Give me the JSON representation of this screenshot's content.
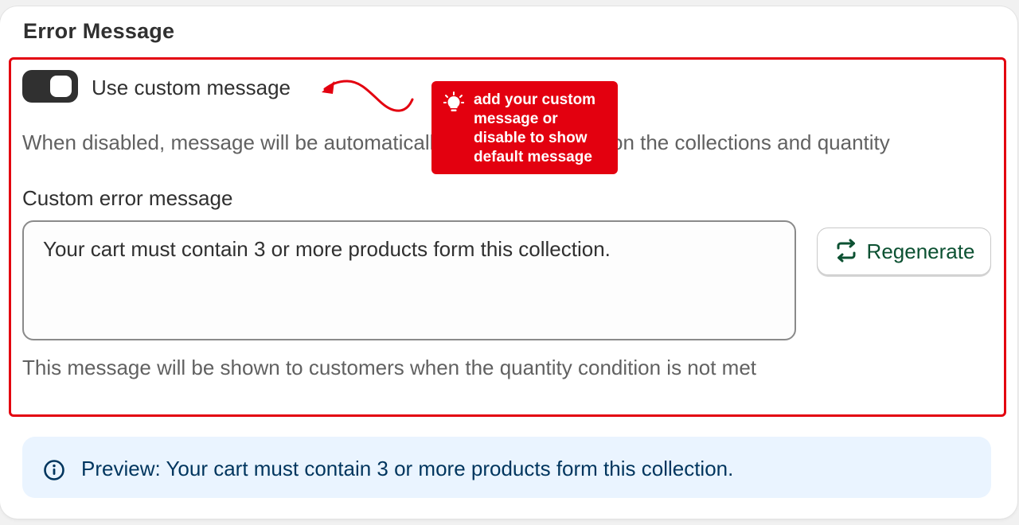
{
  "section": {
    "title": "Error Message"
  },
  "toggle": {
    "label": "Use custom message",
    "checked": true
  },
  "help": {
    "text": "When disabled, message will be automatically generated based on the collections and quantity"
  },
  "custom_message": {
    "label": "Custom error message",
    "value": "Your cart must contain 3 or more products form this collection.",
    "help": "This message will be shown to customers when the quantity condition is not met"
  },
  "regenerate": {
    "label": "Regenerate",
    "icon": "refresh-icon"
  },
  "preview": {
    "icon": "info-icon",
    "text": "Preview: Your cart must contain 3 or more products form this collection."
  },
  "annotation": {
    "icon": "lightbulb-icon",
    "text": "add your custom message or disable to show default message",
    "color": "#e3000f"
  },
  "colors": {
    "highlight": "#e3000f",
    "toggle_on": "#303030",
    "regenerate_text": "#0c5132",
    "preview_bg": "#eaf4ff",
    "preview_text": "#00355e"
  }
}
